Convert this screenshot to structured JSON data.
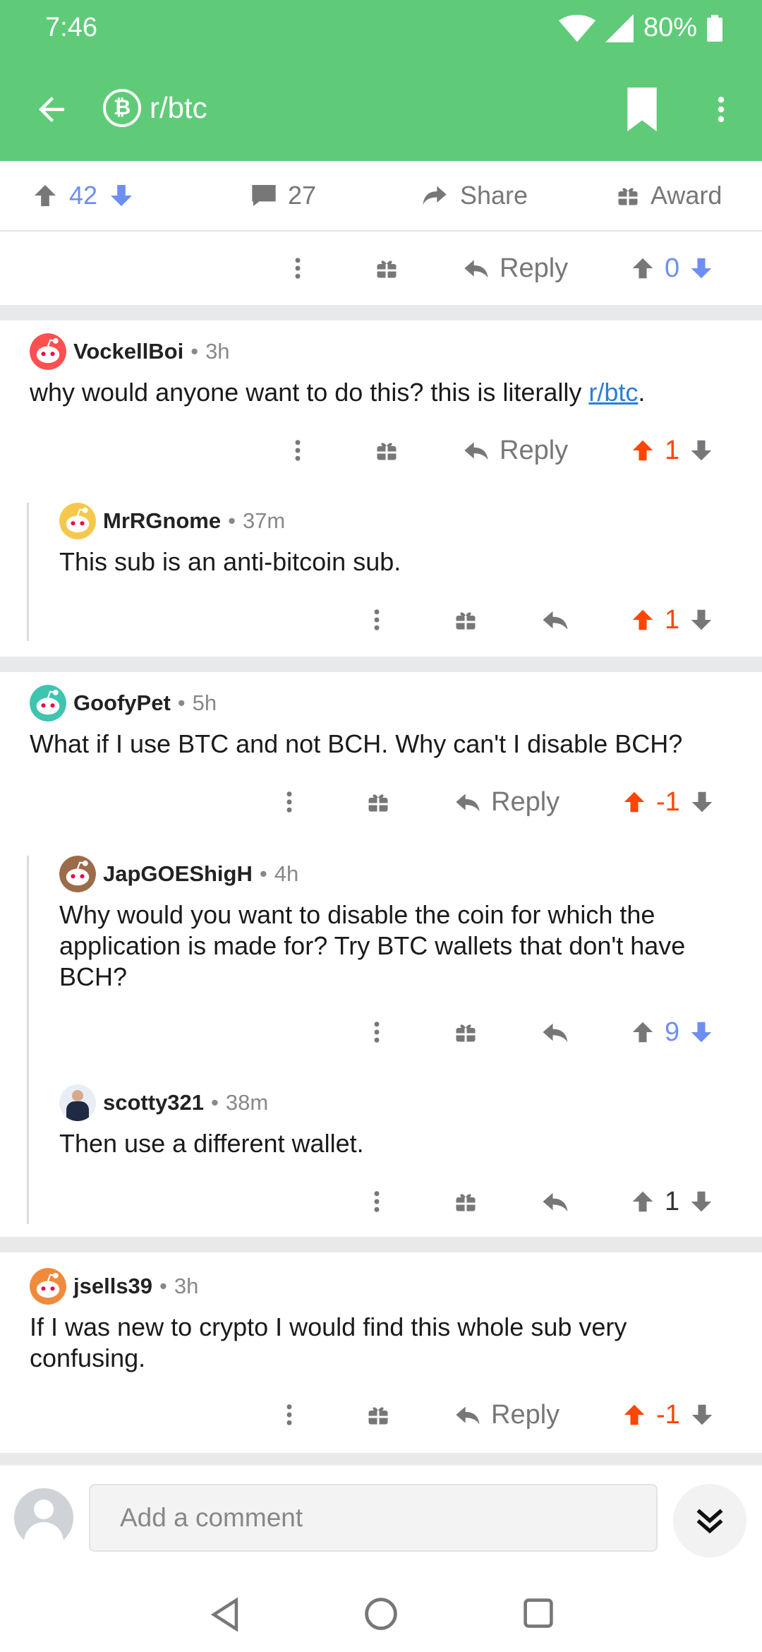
{
  "status": {
    "time": "7:46",
    "battery": "80%"
  },
  "appbar": {
    "subreddit": "r/btc",
    "coin_symbol": "₿"
  },
  "post_actions": {
    "upvotes": "42",
    "comments": "27",
    "share": "Share",
    "award": "Award"
  },
  "prev_comment_actions": {
    "reply": "Reply",
    "score": "0"
  },
  "comments": [
    {
      "user": "VockellBoi",
      "time": "3h",
      "text_before": "why would anyone want to do this? this is literally ",
      "link": "r/btc",
      "text_after": ".",
      "reply": "Reply",
      "score": "1"
    },
    {
      "user": "MrRGnome",
      "time": "37m",
      "text": "This sub is an anti-bitcoin sub.",
      "score": "1"
    },
    {
      "user": "GoofyPet",
      "time": "5h",
      "text": "What if I use BTC and not BCH. Why can't I disable BCH?",
      "reply": "Reply",
      "score": "-1"
    },
    {
      "user": "JapGOEShigH",
      "time": "4h",
      "text": "Why would you want to disable the coin for which the application is made for? Try BTC wallets that don't have BCH?",
      "score": "9"
    },
    {
      "user": "scotty321",
      "time": "38m",
      "text": "Then use a different wallet.",
      "score": "1"
    },
    {
      "user": "jsells39",
      "time": "3h",
      "text": "If I was new to crypto I would find this whole sub very confusing.",
      "reply": "Reply",
      "score": "-1"
    }
  ],
  "composer": {
    "placeholder": "Add a comment"
  },
  "colors": {
    "header": "#5fcb79",
    "upvote": "#ff4500",
    "downvote_active": "#6d8ff2"
  }
}
